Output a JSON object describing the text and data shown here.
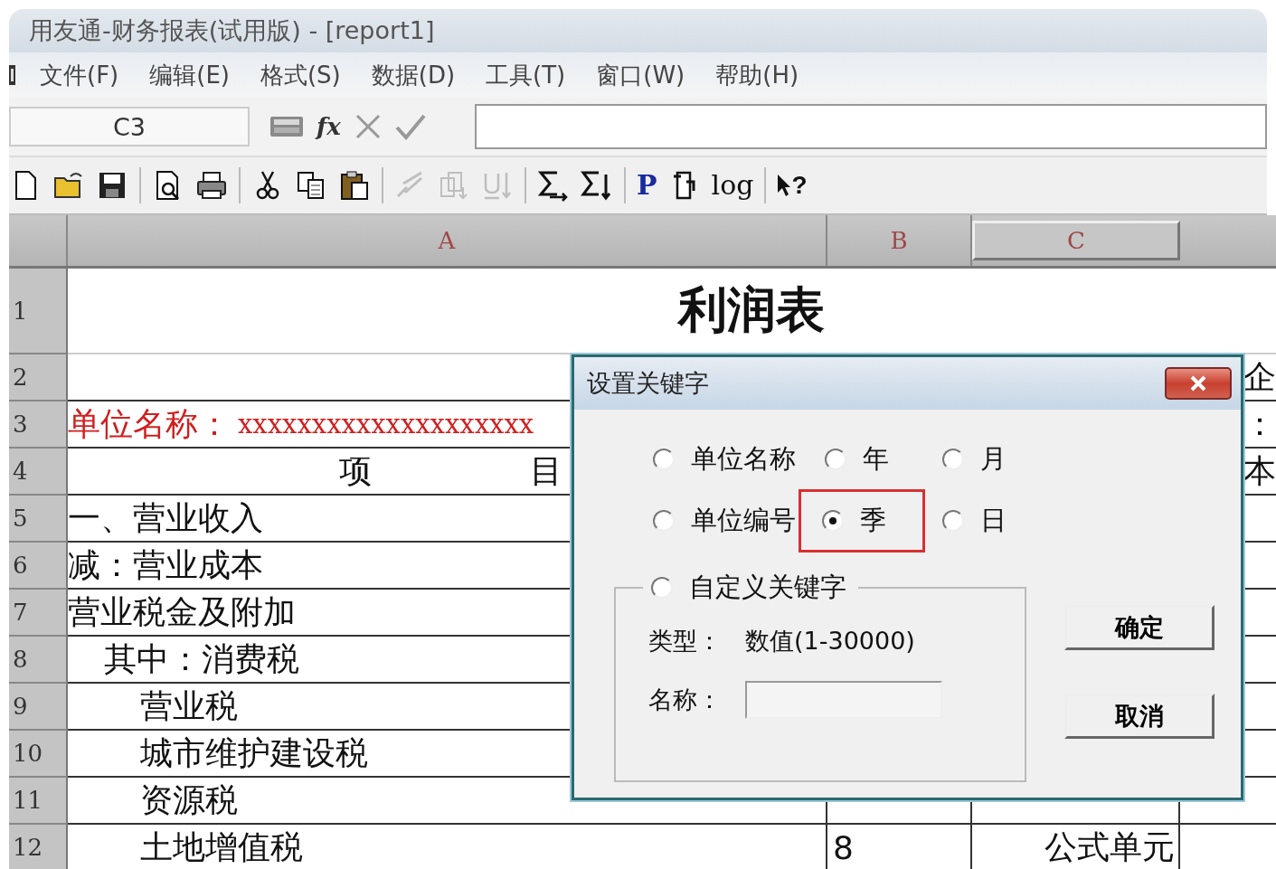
{
  "window": {
    "title": "用友通-财务报表(试用版) - [report1]"
  },
  "menu": [
    {
      "label": "文件(F)"
    },
    {
      "label": "编辑(E)"
    },
    {
      "label": "格式(S)"
    },
    {
      "label": "数据(D)"
    },
    {
      "label": "工具(T)"
    },
    {
      "label": "窗口(W)"
    },
    {
      "label": "帮助(H)"
    }
  ],
  "formula_bar": {
    "cell_ref": "C3",
    "fx": "fx"
  },
  "toolbar": [
    {
      "kind": "new",
      "disabled": false
    },
    {
      "kind": "open",
      "disabled": false
    },
    {
      "kind": "save",
      "disabled": false
    },
    {
      "kind": "separator"
    },
    {
      "kind": "preview",
      "disabled": false
    },
    {
      "kind": "print",
      "disabled": false
    },
    {
      "kind": "separator"
    },
    {
      "kind": "cut",
      "disabled": false
    },
    {
      "kind": "copy",
      "disabled": false
    },
    {
      "kind": "paste",
      "disabled": false
    },
    {
      "kind": "separator"
    },
    {
      "kind": "brush",
      "disabled": true
    },
    {
      "kind": "insert",
      "disabled": true
    },
    {
      "kind": "sort",
      "disabled": true
    },
    {
      "kind": "separator"
    },
    {
      "kind": "sum",
      "disabled": false
    },
    {
      "kind": "sumdown",
      "disabled": false
    },
    {
      "kind": "separator"
    },
    {
      "kind": "letter",
      "label": "P",
      "disabled": false
    },
    {
      "kind": "page",
      "disabled": false
    },
    {
      "kind": "text",
      "label": "log",
      "disabled": false
    },
    {
      "kind": "separator"
    },
    {
      "kind": "help",
      "label": "?",
      "disabled": false
    }
  ],
  "sheet": {
    "columns": [
      {
        "label": "A",
        "selected": false
      },
      {
        "label": "B",
        "selected": false
      },
      {
        "label": "C",
        "selected": true
      }
    ],
    "rows": [
      {
        "number": "1",
        "kind": "title",
        "a": "利润表"
      },
      {
        "number": "2",
        "d": "企"
      },
      {
        "number": "3",
        "kind": "unit",
        "a": "单位名称：",
        "a2": "xxxxxxxxxxxxxxxxxxxx",
        "d": "："
      },
      {
        "number": "4",
        "kind": "header",
        "a": "项",
        "a2": "目",
        "d": "本"
      },
      {
        "number": "5",
        "a": "一、营业收入"
      },
      {
        "number": "6",
        "a": "减：营业成本"
      },
      {
        "number": "7",
        "a": "营业税金及附加",
        "children": [
          {
            "number": "8",
            "a": "其中：消费税",
            "children": [
              {
                "number": "9",
                "a": "营业税"
              },
              {
                "number": "10",
                "a": "城市维护建设税"
              },
              {
                "number": "11",
                "a": "资源税"
              },
              {
                "number": "12",
                "a": "土地增值税",
                "b": "8",
                "c": "公式单元"
              }
            ]
          }
        ]
      }
    ]
  },
  "dialog": {
    "title": "设置关键字",
    "options": [
      {
        "label": "单位名称",
        "selected": false,
        "highlighted": false
      },
      {
        "label": "年",
        "selected": false,
        "highlighted": false
      },
      {
        "label": "月",
        "selected": false,
        "highlighted": false
      },
      {
        "label": "单位编号",
        "selected": false,
        "highlighted": false
      },
      {
        "label": "季",
        "selected": true,
        "highlighted": true
      },
      {
        "label": "日",
        "selected": false,
        "highlighted": false
      }
    ],
    "custom": {
      "label": "自定义关键字",
      "selected": false,
      "type_label": "类型：",
      "type_value": "数值(1-30000)",
      "name_label": "名称："
    },
    "buttons": [
      {
        "label": "确定"
      },
      {
        "label": "取消"
      }
    ]
  }
}
